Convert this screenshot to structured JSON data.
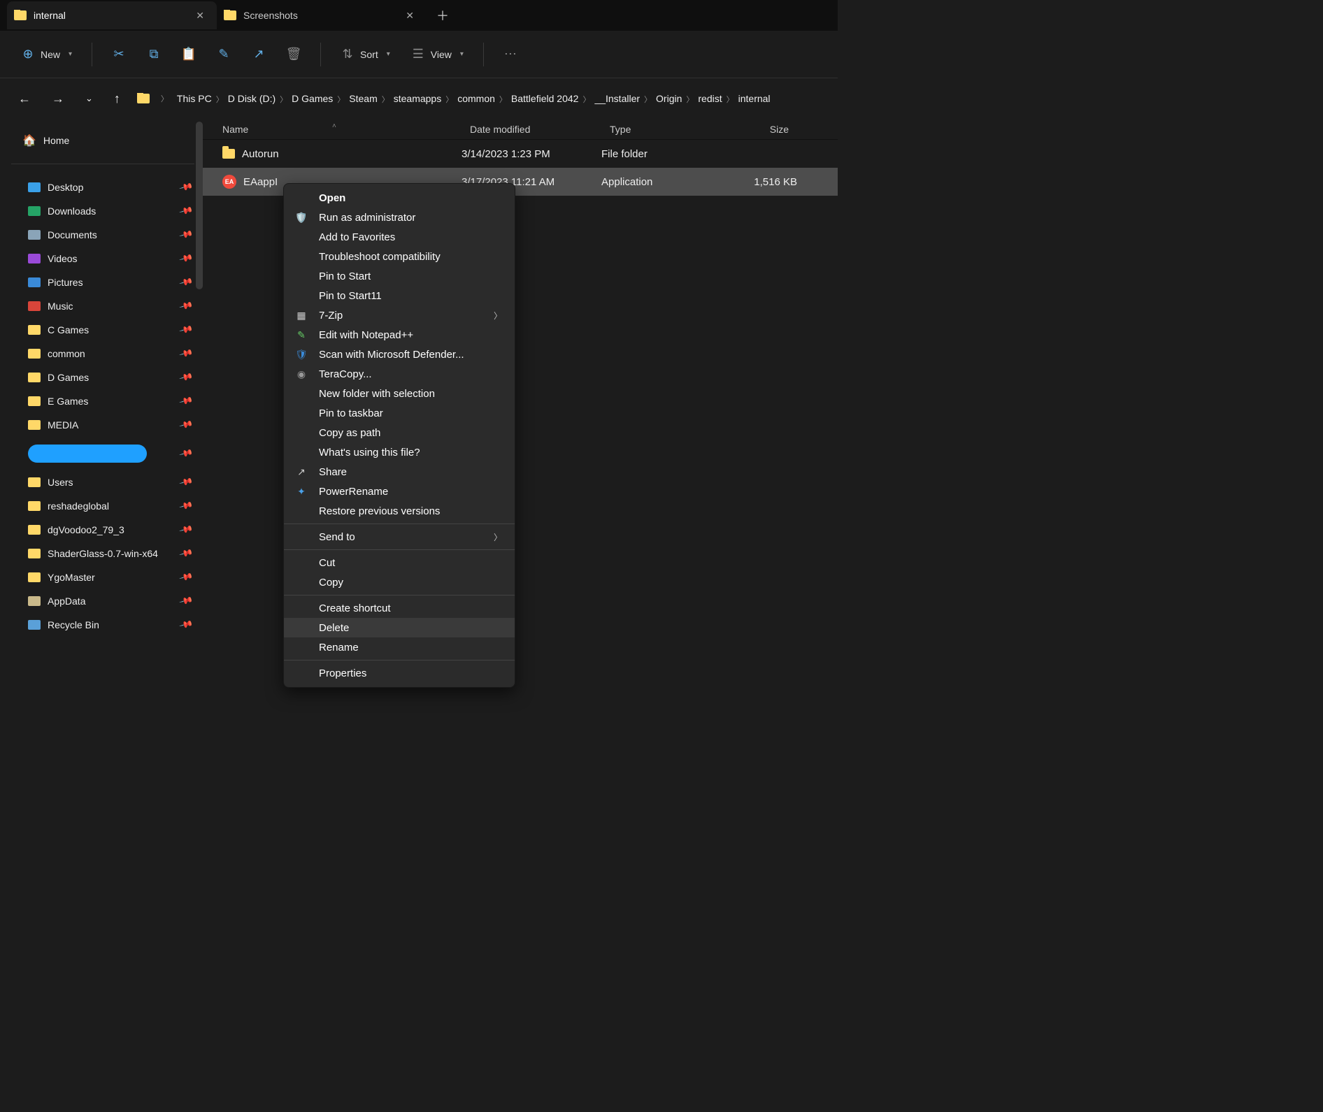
{
  "tabs": [
    {
      "label": "internal",
      "active": true
    },
    {
      "label": "Screenshots",
      "active": false
    }
  ],
  "toolbar": {
    "new": "New",
    "sort": "Sort",
    "view": "View"
  },
  "breadcrumb": [
    "This PC",
    "D Disk (D:)",
    "D Games",
    "Steam",
    "steamapps",
    "common",
    "Battlefield 2042",
    "__Installer",
    "Origin",
    "redist",
    "internal"
  ],
  "columns": {
    "name": "Name",
    "date": "Date modified",
    "type": "Type",
    "size": "Size"
  },
  "rows": [
    {
      "name": "Autorun",
      "date": "3/14/2023 1:23 PM",
      "type": "File folder",
      "size": "",
      "kind": "folder",
      "selected": false
    },
    {
      "name": "EAappInstaller",
      "date": "3/17/2023 11:21 AM",
      "type": "Application",
      "size": "1,516 KB",
      "kind": "app",
      "selected": true,
      "truncName": "EAappI"
    }
  ],
  "sidebar": {
    "home": "Home",
    "items": [
      {
        "label": "Desktop",
        "icon": "desktop",
        "color": "#3aa0e8"
      },
      {
        "label": "Downloads",
        "icon": "downloads",
        "color": "#25a366"
      },
      {
        "label": "Documents",
        "icon": "documents",
        "color": "#8aa4b8"
      },
      {
        "label": "Videos",
        "icon": "videos",
        "color": "#9a4ad8"
      },
      {
        "label": "Pictures",
        "icon": "pictures",
        "color": "#3a8ad8"
      },
      {
        "label": "Music",
        "icon": "music",
        "color": "#d8453a"
      },
      {
        "label": "C Games",
        "icon": "folder",
        "color": "#ffd868"
      },
      {
        "label": "common",
        "icon": "folder",
        "color": "#ffd868"
      },
      {
        "label": "D Games",
        "icon": "folder",
        "color": "#ffd868"
      },
      {
        "label": "E Games",
        "icon": "folder",
        "color": "#ffd868"
      },
      {
        "label": "MEDIA",
        "icon": "folder",
        "color": "#ffd868"
      },
      {
        "label": "[redacted]",
        "icon": "scribble",
        "color": "#1fa0ff"
      },
      {
        "label": "Users",
        "icon": "folder",
        "color": "#ffd868"
      },
      {
        "label": "reshadeglobal",
        "icon": "folder",
        "color": "#ffd868"
      },
      {
        "label": "dgVoodoo2_79_3",
        "icon": "folder",
        "color": "#ffd868"
      },
      {
        "label": "ShaderGlass-0.7-win-x64",
        "icon": "folder",
        "color": "#ffd868"
      },
      {
        "label": "YgoMaster",
        "icon": "folder",
        "color": "#ffd868"
      },
      {
        "label": "AppData",
        "icon": "folder",
        "color": "#c9b98a"
      },
      {
        "label": "Recycle Bin",
        "icon": "recycle",
        "color": "#5aa0d8"
      }
    ]
  },
  "context": {
    "open": "Open",
    "runadmin": "Run as administrator",
    "addfav": "Add to Favorites",
    "troubleshoot": "Troubleshoot compatibility",
    "pinstart": "Pin to Start",
    "pinstart11": "Pin to Start11",
    "sevenzip": "7-Zip",
    "editnpp": "Edit with Notepad++",
    "defender": "Scan with Microsoft Defender...",
    "teracopy": "TeraCopy...",
    "newfoldersel": "New folder with selection",
    "pintaskbar": "Pin to taskbar",
    "copypath": "Copy as path",
    "whatsusing": "What's using this file?",
    "share": "Share",
    "powerrename": "PowerRename",
    "restoreprev": "Restore previous versions",
    "sendto": "Send to",
    "cut": "Cut",
    "copy": "Copy",
    "createshortcut": "Create shortcut",
    "delete": "Delete",
    "rename": "Rename",
    "properties": "Properties"
  }
}
